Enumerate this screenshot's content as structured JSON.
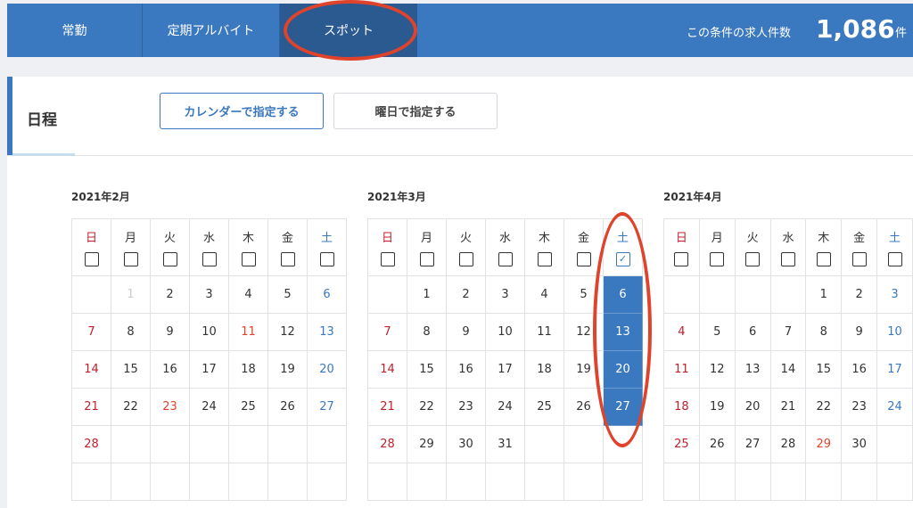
{
  "tabs": [
    {
      "label": "常勤"
    },
    {
      "label": "定期アルバイト"
    },
    {
      "label": "スポット"
    }
  ],
  "count": {
    "label": "この条件の求人件数",
    "value": "1,086",
    "unit": "件"
  },
  "section": {
    "title": "日程"
  },
  "buttons": {
    "calendar": "カレンダーで指定する",
    "weekday": "曜日で指定する"
  },
  "weekdays": [
    "日",
    "月",
    "火",
    "水",
    "木",
    "金",
    "土"
  ],
  "months": [
    {
      "title": "2021年2月",
      "weeks": [
        [
          "",
          "1",
          "2",
          "3",
          "4",
          "5",
          "6"
        ],
        [
          "7",
          "8",
          "9",
          "10",
          "11",
          "12",
          "13"
        ],
        [
          "14",
          "15",
          "16",
          "17",
          "18",
          "19",
          "20"
        ],
        [
          "21",
          "22",
          "23",
          "24",
          "25",
          "26",
          "27"
        ],
        [
          "28",
          "",
          "",
          "",
          "",
          "",
          ""
        ],
        [
          "",
          "",
          "",
          "",
          "",
          "",
          ""
        ]
      ],
      "muted_days": [
        "1"
      ],
      "holidays": [
        "11",
        "23"
      ],
      "checked_column": null
    },
    {
      "title": "2021年3月",
      "weeks": [
        [
          "",
          "1",
          "2",
          "3",
          "4",
          "5",
          "6"
        ],
        [
          "7",
          "8",
          "9",
          "10",
          "11",
          "12",
          "13"
        ],
        [
          "14",
          "15",
          "16",
          "17",
          "18",
          "19",
          "20"
        ],
        [
          "21",
          "22",
          "23",
          "24",
          "25",
          "26",
          "27"
        ],
        [
          "28",
          "29",
          "30",
          "31",
          "",
          "",
          ""
        ],
        [
          "",
          "",
          "",
          "",
          "",
          "",
          ""
        ]
      ],
      "muted_days": [],
      "holidays": [],
      "checked_column": 6
    },
    {
      "title": "2021年4月",
      "weeks": [
        [
          "",
          "",
          "",
          "",
          "1",
          "2",
          "3"
        ],
        [
          "4",
          "5",
          "6",
          "7",
          "8",
          "9",
          "10"
        ],
        [
          "11",
          "12",
          "13",
          "14",
          "15",
          "16",
          "17"
        ],
        [
          "18",
          "19",
          "20",
          "21",
          "22",
          "23",
          "24"
        ],
        [
          "25",
          "26",
          "27",
          "28",
          "29",
          "30",
          ""
        ],
        [
          "",
          "",
          "",
          "",
          "",
          "",
          ""
        ]
      ],
      "muted_days": [],
      "holidays": [
        "29"
      ],
      "checked_column": null
    }
  ],
  "colors": {
    "primary": "#3a78bf",
    "sunday": "#c0202c",
    "holiday": "#e0432b",
    "annotation": "#e0432b"
  },
  "check_glyph": "✓"
}
